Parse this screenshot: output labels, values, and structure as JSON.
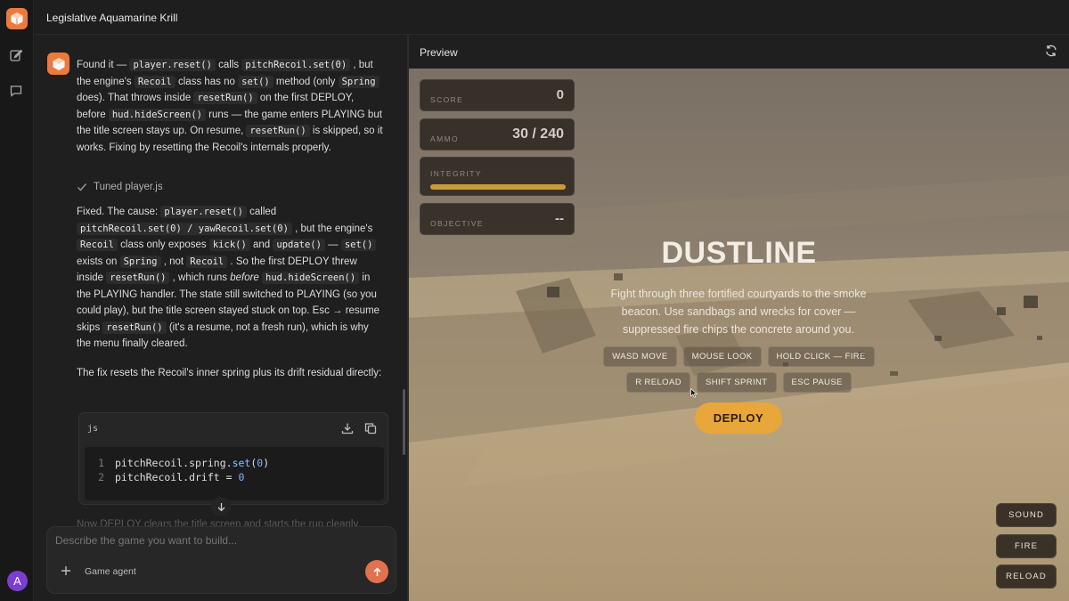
{
  "app": {
    "title": "Legislative Aquamarine Krill",
    "user_initial": "A"
  },
  "chat": {
    "message1": {
      "t1": "Found it — ",
      "c1": "player.reset()",
      "t2": " calls ",
      "c2": "pitchRecoil.set(0)",
      "t3": " , but the engine's ",
      "c3": "Recoil",
      "t4": " class has no ",
      "c4": "set()",
      "t5": " method (only ",
      "c5": "Spring",
      "t6": " does). That throws inside ",
      "c6": "resetRun()",
      "t7": " on the first DEPLOY, before ",
      "c7": "hud.hideScreen()",
      "t8": " runs — the game enters PLAYING but the title screen stays up. On resume, ",
      "c8": "resetRun()",
      "t9": " is skipped, so it works. Fixing by resetting the Recoil's internals properly."
    },
    "tuned_label": "Tuned player.js",
    "message2": {
      "t1": "Fixed. The cause: ",
      "c1": "player.reset()",
      "t2": " called ",
      "c2": "pitchRecoil.set(0) / yawRecoil.set(0)",
      "t3": " , but the engine's ",
      "c3": "Recoil",
      "t4": " class only exposes ",
      "c4": "kick()",
      "t5": " and ",
      "c5": "update()",
      "t6": " — ",
      "c6": "set()",
      "t7": " exists on ",
      "c7": "Spring",
      "t8": " , not ",
      "c8": "Recoil",
      "t9": " . So the first DEPLOY threw inside ",
      "c9": "resetRun()",
      "t10": " , which runs ",
      "em": "before",
      "c10": "hud.hideScreen()",
      "t11": " in the PLAYING handler. The state still switched to PLAYING (so you could play), but the title screen stayed stuck on top. Esc → resume skips ",
      "c11": "resetRun()",
      "t12": " (it's a resume, not a fresh run), which is why the menu finally cleared."
    },
    "message3": "The fix resets the Recoil's inner spring plus its drift residual directly:",
    "code": {
      "lang": "js",
      "lines": [
        {
          "n": "1",
          "obj": "pitchRecoil.spring.",
          "fn": "set",
          "open": "(",
          "num": "0",
          "close": ")"
        },
        {
          "n": "2",
          "obj": "pitchRecoil.drift = ",
          "num": "0"
        }
      ]
    },
    "faded_text": "Now DEPLOY clears the title screen and starts the run cleanly.",
    "composer": {
      "placeholder": "Describe the game you want to build...",
      "agent_label": "Game agent"
    }
  },
  "preview": {
    "header_title": "Preview",
    "hud": {
      "score_label": "SCORE",
      "score_value": "0",
      "ammo_label": "AMMO",
      "ammo_value": "30 / 240",
      "integrity_label": "INTEGRITY",
      "integrity_level": 1.0,
      "objective_label": "OBJECTIVE",
      "objective_value": "--"
    },
    "game_title": "DUSTLINE",
    "description": "Fight through three fortified courtyards to the smoke beacon. Use sandbags and wrecks for cover — suppressed fire chips the concrete around you.",
    "controls_row1": [
      "WASD MOVE",
      "MOUSE LOOK",
      "HOLD CLICK — FIRE"
    ],
    "controls_row2": [
      "R RELOAD",
      "SHIFT SPRINT",
      "ESC PAUSE"
    ],
    "deploy_label": "DEPLOY",
    "side_buttons": {
      "sound": "SOUND",
      "fire": "FIRE",
      "reload": "RELOAD"
    }
  },
  "colors": {
    "accent": "#ec7a3c",
    "deploy": "#e9a63a",
    "integrity": "#c89c38",
    "send": "#e2714d",
    "avatar": "#7a3fd1"
  }
}
